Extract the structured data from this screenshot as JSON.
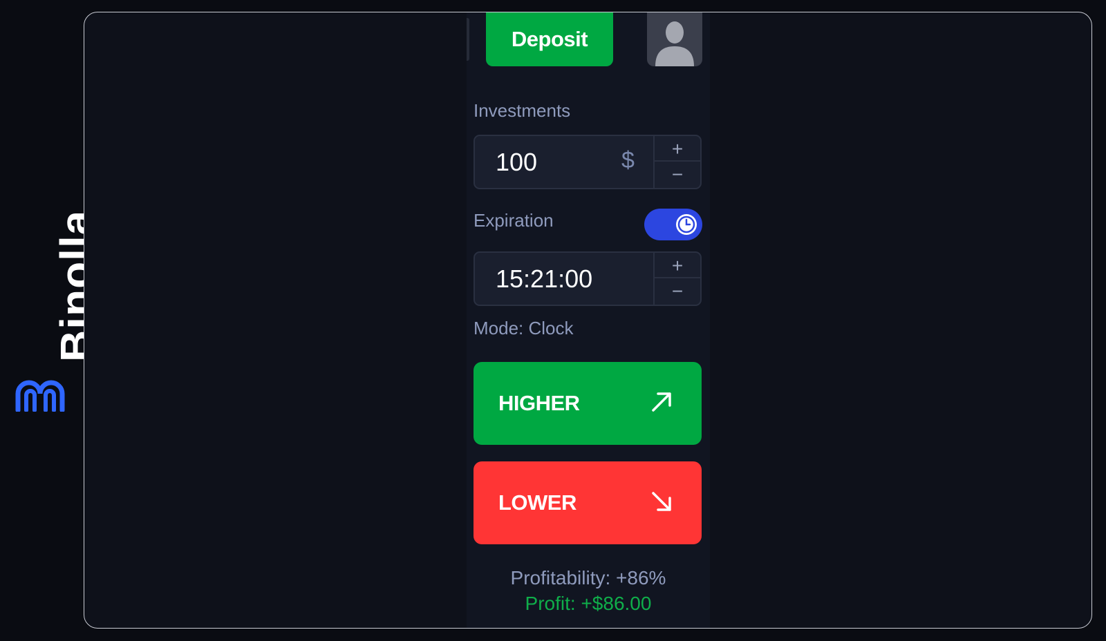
{
  "brand": {
    "name": "Binolla",
    "accent_color": "#2f66ff"
  },
  "header": {
    "deposit_label": "Deposit",
    "avatar_icon": "user-silhouette-icon"
  },
  "investments": {
    "label": "Investments",
    "value": "100",
    "currency": "$",
    "plus_label": "+",
    "minus_label": "−"
  },
  "expiration": {
    "label": "Expiration",
    "toggle_on": true,
    "toggle_icon": "clock-icon",
    "value": "15:21:00",
    "plus_label": "+",
    "minus_label": "−",
    "mode_text": "Mode: Clock"
  },
  "trade": {
    "higher_label": "HIGHER",
    "higher_icon": "arrow-up-right-icon",
    "higher_color": "#00a842",
    "lower_label": "LOWER",
    "lower_icon": "arrow-down-right-icon",
    "lower_color": "#ff3535"
  },
  "summary": {
    "profitability_text": "Profitability: +86%",
    "profit_text": "Profit: +$86.00"
  }
}
